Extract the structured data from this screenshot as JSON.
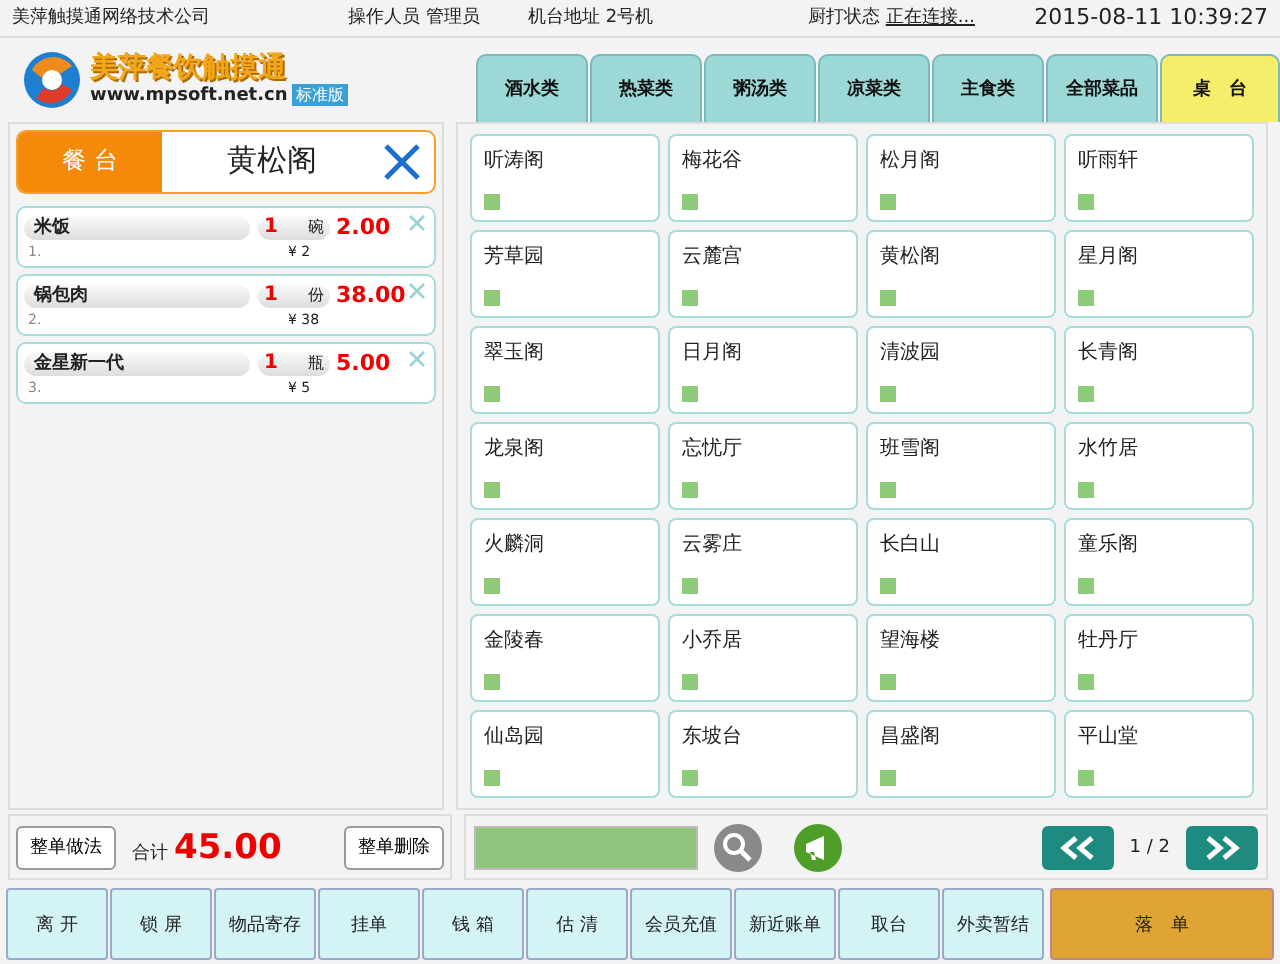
{
  "status_bar": {
    "company": "美萍触摸通网络技术公司",
    "operator_label": "操作人员",
    "operator": "管理员",
    "terminal_label": "机台地址",
    "terminal": "2号机",
    "printer_label": "厨打状态",
    "printer_status": "正在连接...",
    "datetime": "2015-08-11 10:39:27"
  },
  "logo": {
    "name": "美萍餐饮触摸通",
    "url": "www.mpsoft.net.cn",
    "edition": "标准版"
  },
  "tabs": [
    {
      "label": "酒水类",
      "selected": false
    },
    {
      "label": "热菜类",
      "selected": false
    },
    {
      "label": "粥汤类",
      "selected": false
    },
    {
      "label": "凉菜类",
      "selected": false
    },
    {
      "label": "主食类",
      "selected": false
    },
    {
      "label": "全部菜品",
      "selected": false
    },
    {
      "label": "桌　台",
      "selected": true
    }
  ],
  "order": {
    "table_label": "餐 台",
    "table_name": "黄松阁",
    "items": [
      {
        "index": "1.",
        "name": "米饭",
        "qty": "1",
        "unit": "碗",
        "amount": "2.00",
        "unit_price": "¥ 2"
      },
      {
        "index": "2.",
        "name": "锅包肉",
        "qty": "1",
        "unit": "份",
        "amount": "38.00",
        "unit_price": "¥ 38"
      },
      {
        "index": "3.",
        "name": "金星新一代",
        "qty": "1",
        "unit": "瓶",
        "amount": "5.00",
        "unit_price": "¥ 5"
      }
    ],
    "method_button": "整单做法",
    "total_label": "合计",
    "total": "45.00",
    "delete_button": "整单删除"
  },
  "tables": [
    {
      "name": "听涛阁",
      "color": "#8fc97a"
    },
    {
      "name": "梅花谷",
      "color": "#8fc97a"
    },
    {
      "name": "松月阁",
      "color": "#8fc97a"
    },
    {
      "name": "听雨轩",
      "color": "#8fc97a"
    },
    {
      "name": "芳草园",
      "color": "#8fc97a"
    },
    {
      "name": "云麓宫",
      "color": "#8fc97a"
    },
    {
      "name": "黄松阁",
      "color": "#8fc97a"
    },
    {
      "name": "星月阁",
      "color": "#8fc97a"
    },
    {
      "name": "翠玉阁",
      "color": "#8fc97a"
    },
    {
      "name": "日月阁",
      "color": "#8fc97a"
    },
    {
      "name": "清波园",
      "color": "#8fc97a"
    },
    {
      "name": "长青阁",
      "color": "#8fc97a"
    },
    {
      "name": "龙泉阁",
      "color": "#8fc97a"
    },
    {
      "name": "忘忧厅",
      "color": "#8fc97a"
    },
    {
      "name": "班雪阁",
      "color": "#8fc97a"
    },
    {
      "name": "水竹居",
      "color": "#8fc97a"
    },
    {
      "name": "火麟洞",
      "color": "#8fc97a"
    },
    {
      "name": "云雾庄",
      "color": "#8fc97a"
    },
    {
      "name": "长白山",
      "color": "#8fc97a"
    },
    {
      "name": "童乐阁",
      "color": "#8fc97a"
    },
    {
      "name": "金陵春",
      "color": "#8fc97a"
    },
    {
      "name": "小乔居",
      "color": "#8fc97a"
    },
    {
      "name": "望海楼",
      "color": "#8fc97a"
    },
    {
      "name": "牡丹厅",
      "color": "#8fc97a"
    },
    {
      "name": "仙岛园",
      "color": "#8fc97a"
    },
    {
      "name": "东坡台",
      "color": "#8fc97a"
    },
    {
      "name": "昌盛阁",
      "color": "#8fc97a"
    },
    {
      "name": "平山堂",
      "color": "#8fc97a"
    }
  ],
  "pager": {
    "page": "1 / 2"
  },
  "actions": [
    {
      "label": "离 开",
      "kind": "normal"
    },
    {
      "label": "锁 屏",
      "kind": "normal"
    },
    {
      "label": "物品寄存",
      "kind": "normal"
    },
    {
      "label": "挂单",
      "kind": "normal"
    },
    {
      "label": "钱 箱",
      "kind": "normal"
    },
    {
      "label": "估 清",
      "kind": "normal"
    },
    {
      "label": "会员充值",
      "kind": "normal"
    },
    {
      "label": "新近账单",
      "kind": "normal"
    },
    {
      "label": "取台",
      "kind": "normal"
    },
    {
      "label": "外卖暂结",
      "kind": "normal"
    },
    {
      "label": "落　单",
      "kind": "primary"
    }
  ]
}
